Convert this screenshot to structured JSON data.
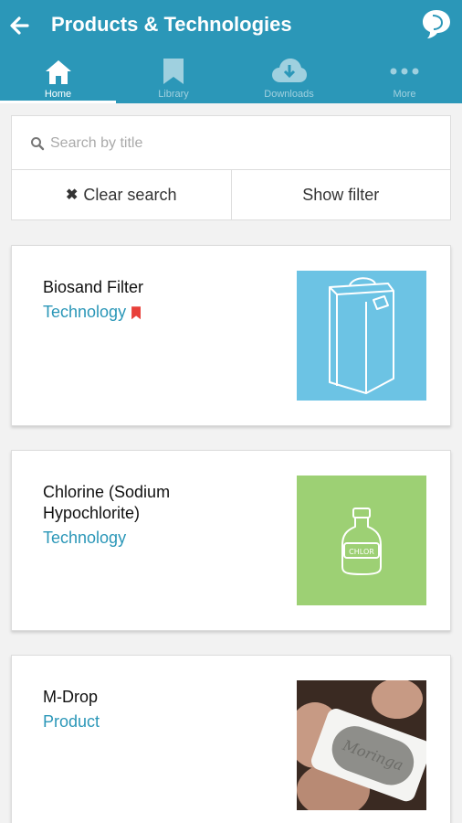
{
  "header": {
    "title": "Products & Technologies"
  },
  "tabs": [
    {
      "label": "Home",
      "icon": "home-icon",
      "active": true
    },
    {
      "label": "Library",
      "icon": "bookmark-icon",
      "active": false
    },
    {
      "label": "Downloads",
      "icon": "cloud-download-icon",
      "active": false
    },
    {
      "label": "More",
      "icon": "more-icon",
      "active": false
    }
  ],
  "search": {
    "placeholder": "Search by title",
    "value": ""
  },
  "actions": {
    "clear_label": "Clear search",
    "filter_label": "Show filter"
  },
  "items": [
    {
      "name": "Biosand Filter",
      "type": "Technology",
      "bookmarked": true,
      "thumb_color": "#6cc3e4"
    },
    {
      "name": "Chlorine (Sodium Hypochlorite)",
      "type": "Technology",
      "bookmarked": false,
      "thumb_color": "#9dd074",
      "thumb_text": "CHLOR"
    },
    {
      "name": "M-Drop",
      "type": "Product",
      "bookmarked": false,
      "thumb_text": "Moringa"
    }
  ],
  "colors": {
    "primary": "#2b97b8",
    "accent": "#e8403a"
  }
}
